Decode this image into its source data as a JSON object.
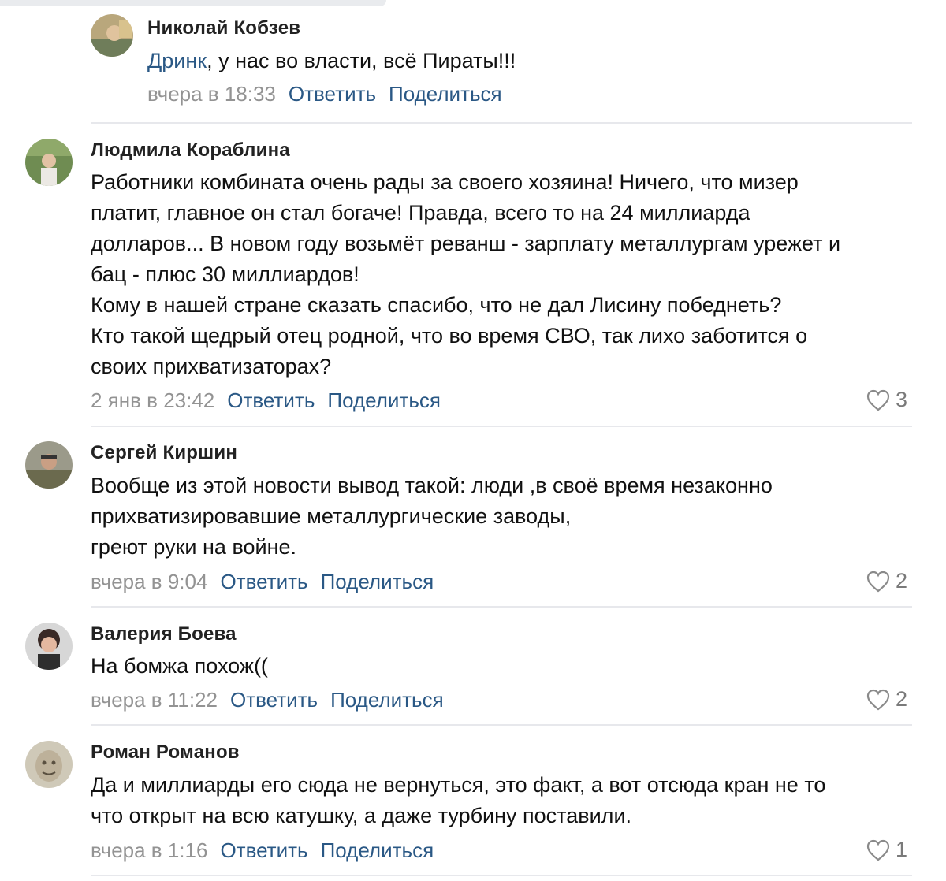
{
  "comments": [
    {
      "author": "Николай Кобзев",
      "mention": "Дринк",
      "lines": [
        ", у нас во власти, всё Пираты!!!"
      ],
      "time": "вчера в 18:33",
      "reply": "Ответить",
      "share": "Поделиться",
      "likes": ""
    },
    {
      "author": "Людмила Кораблина",
      "lines": [
        "Работники комбината очень рады за своего хозяина! Ничего, что мизер",
        "платит, главное он стал богаче! Правда, всего то на 24 миллиарда",
        "долларов... В новом году возьмёт реванш - зарплату металлургам урежет и",
        "бац - плюс 30 миллиардов!",
        "Кому в нашей стране сказать спасибо, что не дал Лисину победнеть?",
        "Кто такой щедрый отец родной, что во время СВО, так лихо заботится о",
        "своих прихватизаторах?"
      ],
      "time": "2 янв в 23:42",
      "reply": "Ответить",
      "share": "Поделиться",
      "likes": "3"
    },
    {
      "author": "Сергей Киршин",
      "lines": [
        "Вообще из этой новости вывод такой: люди ,в своё время незаконно",
        "прихватизировавшие металлургические заводы,",
        "греют руки на войне."
      ],
      "time": "вчера в 9:04",
      "reply": "Ответить",
      "share": "Поделиться",
      "likes": "2"
    },
    {
      "author": "Валерия Боева",
      "lines": [
        "На бомжа похож(("
      ],
      "time": "вчера в 11:22",
      "reply": "Ответить",
      "share": "Поделиться",
      "likes": "2"
    },
    {
      "author": "Роман Романов",
      "lines": [
        "Да и миллиарды его сюда не вернуться, это факт, а вот отсюда кран не то",
        "что открыт на всю катушку, а даже турбину поставили."
      ],
      "time": "вчера в 1:16",
      "reply": "Ответить",
      "share": "Поделиться",
      "likes": "1"
    }
  ],
  "icons": {
    "like": "heart-outline-icon"
  },
  "colors": {
    "link": "#2a5885",
    "meta": "#939393",
    "divider": "#e7e8ec"
  }
}
